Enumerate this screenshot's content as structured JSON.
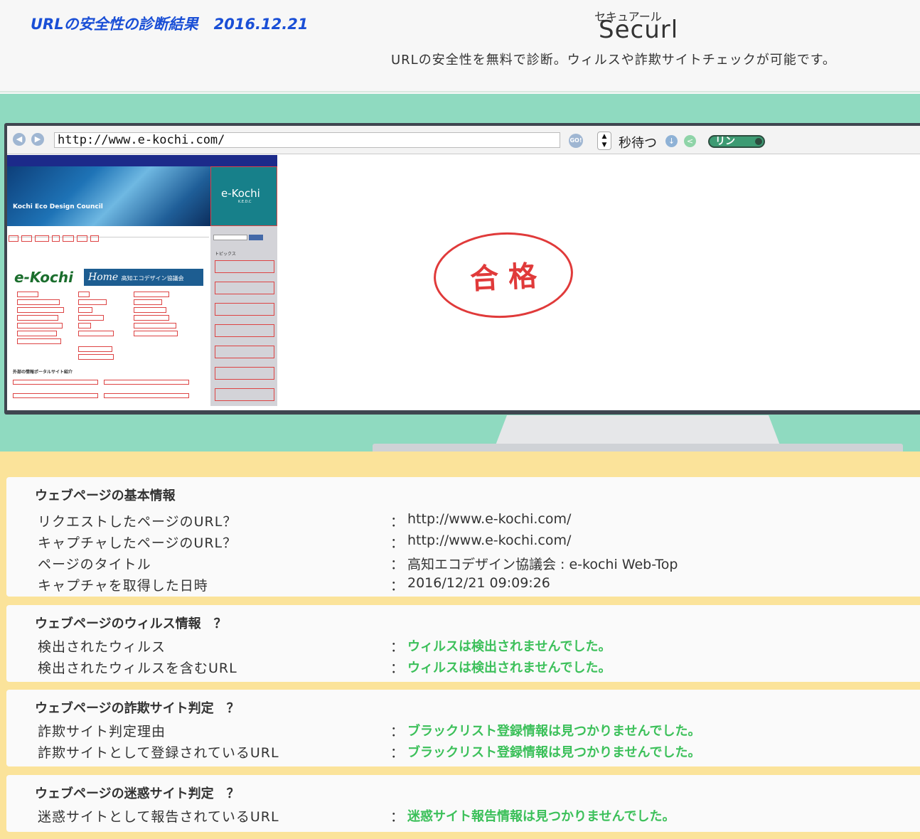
{
  "header": {
    "title": "URLの安全性の診断結果",
    "date": "2016.12.21",
    "brand_ruby": "セキュアール",
    "brand_name": "Securl",
    "tagline": "URLの安全性を無料で診断。ウィルスや詐欺サイトチェックが可能です。"
  },
  "browser": {
    "url": "http://www.e-kochi.com/",
    "go_label": "GO!",
    "wait_label": "秒待つ",
    "link_toggle_label": "リン",
    "icons": {
      "back": "back-arrow-icon",
      "forward": "forward-arrow-icon",
      "stepper": "up-down-stepper-icon",
      "download": "download-icon",
      "share": "share-icon"
    }
  },
  "capture": {
    "banner_text": "Kochi Eco Design Council",
    "logo_text": "e-Kochi",
    "logo_sub": "K.E.D.C",
    "site_logo": "e-Kochi",
    "home_label": "Home",
    "home_sub": "高知エコデザイン協議会",
    "topics_label": "トピックス",
    "portal_label": "外部の情報ポータルサイト紹介"
  },
  "verdict": {
    "label": "合格",
    "color": "#e03a3a"
  },
  "sections": {
    "basic": {
      "title": "ウェブページの基本情報",
      "rows": [
        {
          "label": "リクエストしたページのURL？",
          "value": "http://www.e-kochi.com/"
        },
        {
          "label": "キャプチャしたページのURL？",
          "value": "http://www.e-kochi.com/"
        },
        {
          "label": "ページのタイトル",
          "value": "高知エコデザイン協議会 : e-kochi Web-Top"
        },
        {
          "label": "キャプチャを取得した日時",
          "value": "2016/12/21 09:09:26"
        }
      ]
    },
    "virus": {
      "title": "ウェブページのウィルス情報　？",
      "rows": [
        {
          "label": "検出されたウィルス",
          "value": "ウィルスは検出されませんでした。"
        },
        {
          "label": "検出されたウィルスを含むURL",
          "value": "ウィルスは検出されませんでした。"
        }
      ]
    },
    "fraud": {
      "title": "ウェブページの詐欺サイト判定　？",
      "rows": [
        {
          "label": "詐欺サイト判定理由",
          "value": "ブラックリスト登録情報は見つかりませんでした。"
        },
        {
          "label": "詐欺サイトとして登録されているURL",
          "value": "ブラックリスト登録情報は見つかりませんでした。"
        }
      ]
    },
    "nuisance": {
      "title": "ウェブページの迷惑サイト判定　？",
      "rows": [
        {
          "label": "迷惑サイトとして報告されているURL",
          "value": "迷惑サイト報告情報は見つかりませんでした。"
        }
      ]
    }
  },
  "colon": "：",
  "colors": {
    "title_blue": "#1a4fd6",
    "ok_green": "#3cc05a",
    "stage_green": "#8fdac0",
    "info_yellow": "#fbe39a"
  }
}
